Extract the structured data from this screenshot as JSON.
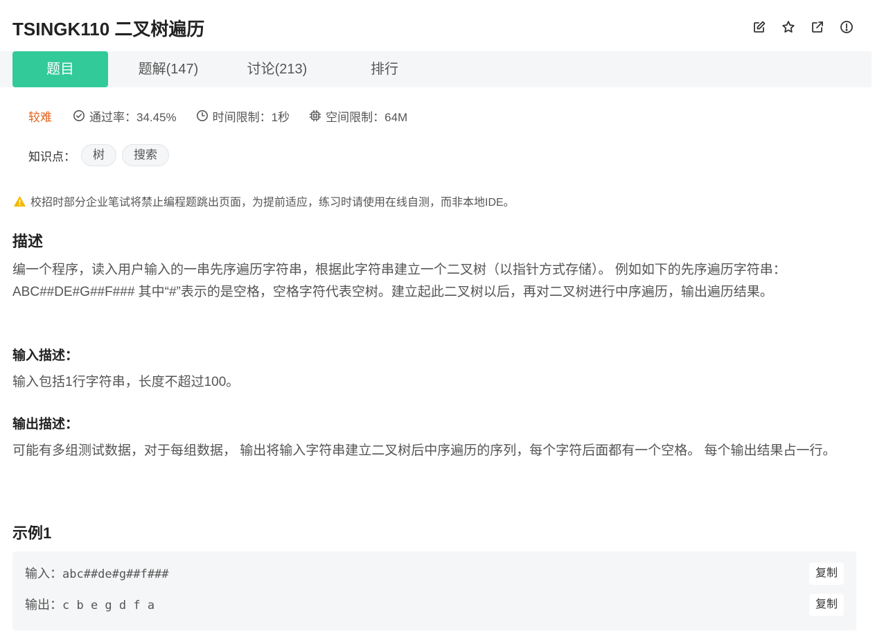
{
  "header": {
    "title": "TSINGK110  二叉树遍历",
    "icons": [
      "edit-icon",
      "star-icon",
      "external-link-icon",
      "info-icon"
    ]
  },
  "tabs": [
    {
      "label": "题目",
      "active": true
    },
    {
      "label": "题解(147)",
      "active": false
    },
    {
      "label": "讨论(213)",
      "active": false
    },
    {
      "label": "排行",
      "active": false
    }
  ],
  "meta": {
    "difficulty": "较难",
    "pass_rate": "通过率：34.45%",
    "time_limit": "时间限制：1秒",
    "space_limit": "空间限制：64M"
  },
  "knowledge": {
    "label": "知识点：",
    "tags": [
      "树",
      "搜索"
    ]
  },
  "notice": "校招时部分企业笔试将禁止编程题跳出页面，为提前适应，练习时请使用在线自测，而非本地IDE。",
  "description": {
    "heading": "描述",
    "text": "编一个程序，读入用户输入的一串先序遍历字符串，根据此字符串建立一个二叉树（以指针方式存储）。 例如如下的先序遍历字符串： ABC##DE#G##F### 其中“#”表示的是空格，空格字符代表空树。建立起此二叉树以后，再对二叉树进行中序遍历，输出遍历结果。"
  },
  "input_desc": {
    "heading": "输入描述：",
    "text": "输入包括1行字符串，长度不超过100。"
  },
  "output_desc": {
    "heading": "输出描述：",
    "text": "可能有多组测试数据，对于每组数据， 输出将输入字符串建立二叉树后中序遍历的序列，每个字符后面都有一个空格。 每个输出结果占一行。"
  },
  "example": {
    "heading": "示例1",
    "input_label": "输入：",
    "input_value": "abc##de#g##f###",
    "output_label": "输出：",
    "output_value": "c b e g d f a",
    "copy_label": "复制"
  },
  "colors": {
    "accent": "#32ca99",
    "difficulty": "#e2631a",
    "warning": "#f5b800"
  }
}
